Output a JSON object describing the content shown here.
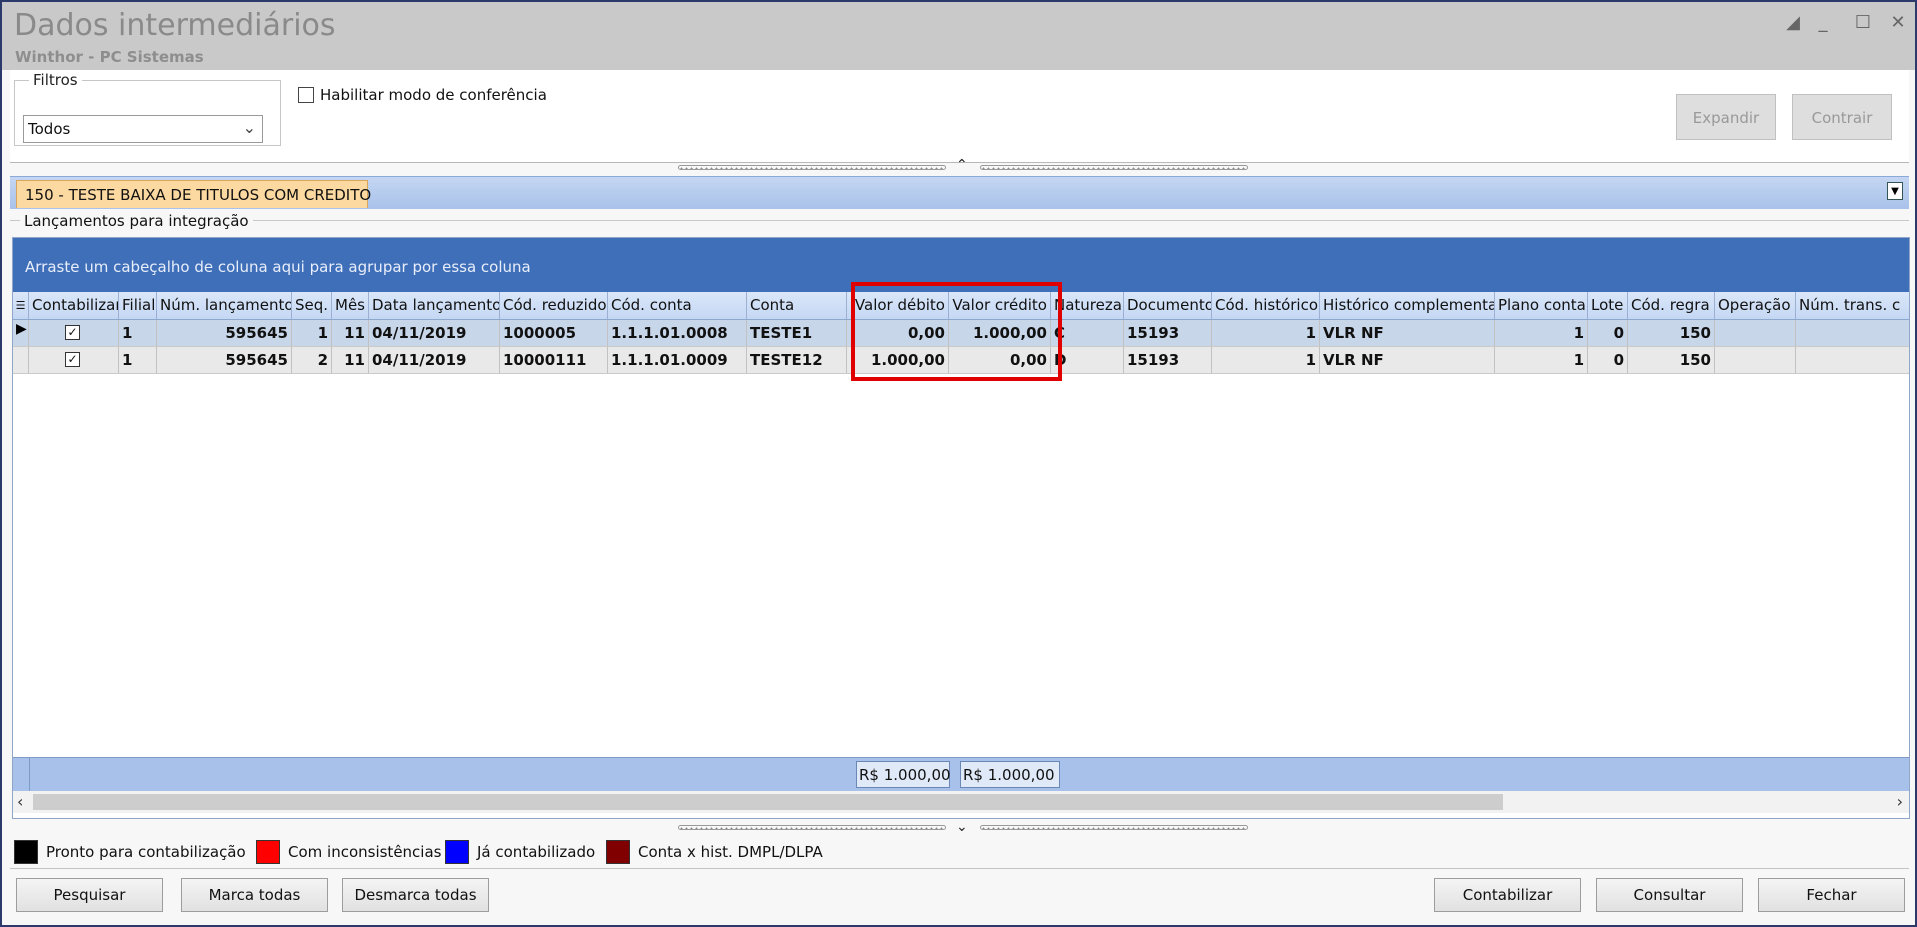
{
  "window": {
    "title": "Dados intermediários",
    "subtitle": "Winthor - PC Sistemas",
    "controls": [
      "restore",
      "minimize",
      "maximize",
      "close"
    ]
  },
  "filters": {
    "legend": "Filtros",
    "selected": "Todos",
    "checkbox_label": "Habilitar modo de conferência",
    "checkbox_checked": false,
    "expand_label": "Expandir",
    "collapse_label": "Contrair"
  },
  "tab": {
    "label": "150 - TESTE BAIXA DE TITULOS COM CREDITO"
  },
  "group_title": "Lançamentos para integração",
  "grid": {
    "group_panel_text": "Arraste um cabeçalho de coluna aqui para agrupar por essa coluna",
    "columns": [
      "Contabilizar",
      "Filial",
      "Núm. lançamento",
      "Seq.",
      "Mês",
      "Data lançamento",
      "Cód. reduzido",
      "Cód. conta",
      "Conta",
      "Valor débito",
      "Valor crédito",
      "Natureza",
      "Documento",
      "Cód. histórico",
      "Histórico complementar",
      "Plano conta",
      "Lote",
      "Cód. regra",
      "Operação",
      "Núm. trans. c"
    ],
    "rows": [
      {
        "contabilizar": true,
        "filial": "1",
        "num_lancamento": "595645",
        "seq": "1",
        "mes": "11",
        "data": "04/11/2019",
        "cod_reduzido": "1000005",
        "cod_conta": "1.1.1.01.0008",
        "conta": "TESTE1",
        "valor_debito": "0,00",
        "valor_credito": "1.000,00",
        "natureza": "C",
        "documento": "15193",
        "cod_historico": "1",
        "historico_comp": "VLR NF",
        "plano_conta": "1",
        "lote": "0",
        "cod_regra": "150",
        "operacao": "",
        "num_trans": ""
      },
      {
        "contabilizar": true,
        "filial": "1",
        "num_lancamento": "595645",
        "seq": "2",
        "mes": "11",
        "data": "04/11/2019",
        "cod_reduzido": "10000111",
        "cod_conta": "1.1.1.01.0009",
        "conta": "TESTE12",
        "valor_debito": "1.000,00",
        "valor_credito": "0,00",
        "natureza": "D",
        "documento": "15193",
        "cod_historico": "1",
        "historico_comp": "VLR NF",
        "plano_conta": "1",
        "lote": "0",
        "cod_regra": "150",
        "operacao": "",
        "num_trans": ""
      }
    ],
    "totals": {
      "valor_debito": "R$ 1.000,00",
      "valor_credito": "R$ 1.000,00"
    }
  },
  "legend": [
    {
      "label": "Pronto para contabilização",
      "color": "#000000"
    },
    {
      "label": "Com inconsistências",
      "color": "#ff0000"
    },
    {
      "label": "Já contabilizado",
      "color": "#0000ff"
    },
    {
      "label": "Conta x hist. DMPL/DLPA",
      "color": "#800000"
    }
  ],
  "buttons": {
    "pesquisar": "Pesquisar",
    "marca_todas": "Marca todas",
    "desmarca_todas": "Desmarca todas",
    "contabilizar": "Contabilizar",
    "consultar": "Consultar",
    "fechar": "Fechar"
  }
}
